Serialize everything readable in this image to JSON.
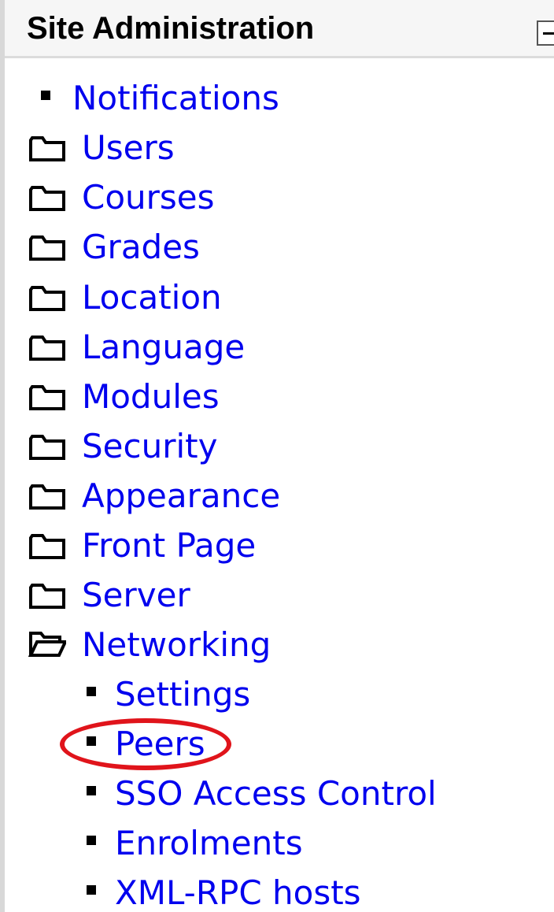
{
  "block": {
    "title": "Site Administration",
    "collapse_icon": "minus-box-icon"
  },
  "items": {
    "notifications": {
      "label": "Notifications",
      "icon": "bullet-icon"
    },
    "users": {
      "label": "Users",
      "icon": "folder-closed-icon"
    },
    "courses": {
      "label": "Courses",
      "icon": "folder-closed-icon"
    },
    "grades": {
      "label": "Grades",
      "icon": "folder-closed-icon"
    },
    "location": {
      "label": "Location",
      "icon": "folder-closed-icon"
    },
    "language": {
      "label": "Language",
      "icon": "folder-closed-icon"
    },
    "modules": {
      "label": "Modules",
      "icon": "folder-closed-icon"
    },
    "security": {
      "label": "Security",
      "icon": "folder-closed-icon"
    },
    "appearance": {
      "label": "Appearance",
      "icon": "folder-closed-icon"
    },
    "front_page": {
      "label": "Front Page",
      "icon": "folder-closed-icon"
    },
    "server": {
      "label": "Server",
      "icon": "folder-closed-icon"
    },
    "networking": {
      "label": "Networking",
      "icon": "folder-open-icon",
      "expanded": true,
      "children": {
        "settings": {
          "label": "Settings",
          "icon": "bullet-icon"
        },
        "peers": {
          "label": "Peers",
          "icon": "bullet-icon",
          "highlighted": true
        },
        "sso_access_control": {
          "label": "SSO Access Control",
          "icon": "bullet-icon"
        },
        "enrolments": {
          "label": "Enrolments",
          "icon": "bullet-icon"
        },
        "xml_rpc_hosts": {
          "label": "XML-RPC hosts",
          "icon": "bullet-icon"
        }
      }
    }
  },
  "colors": {
    "link": "#0000ee",
    "highlight": "#e0141b",
    "header_bg": "#f6f6f6"
  }
}
